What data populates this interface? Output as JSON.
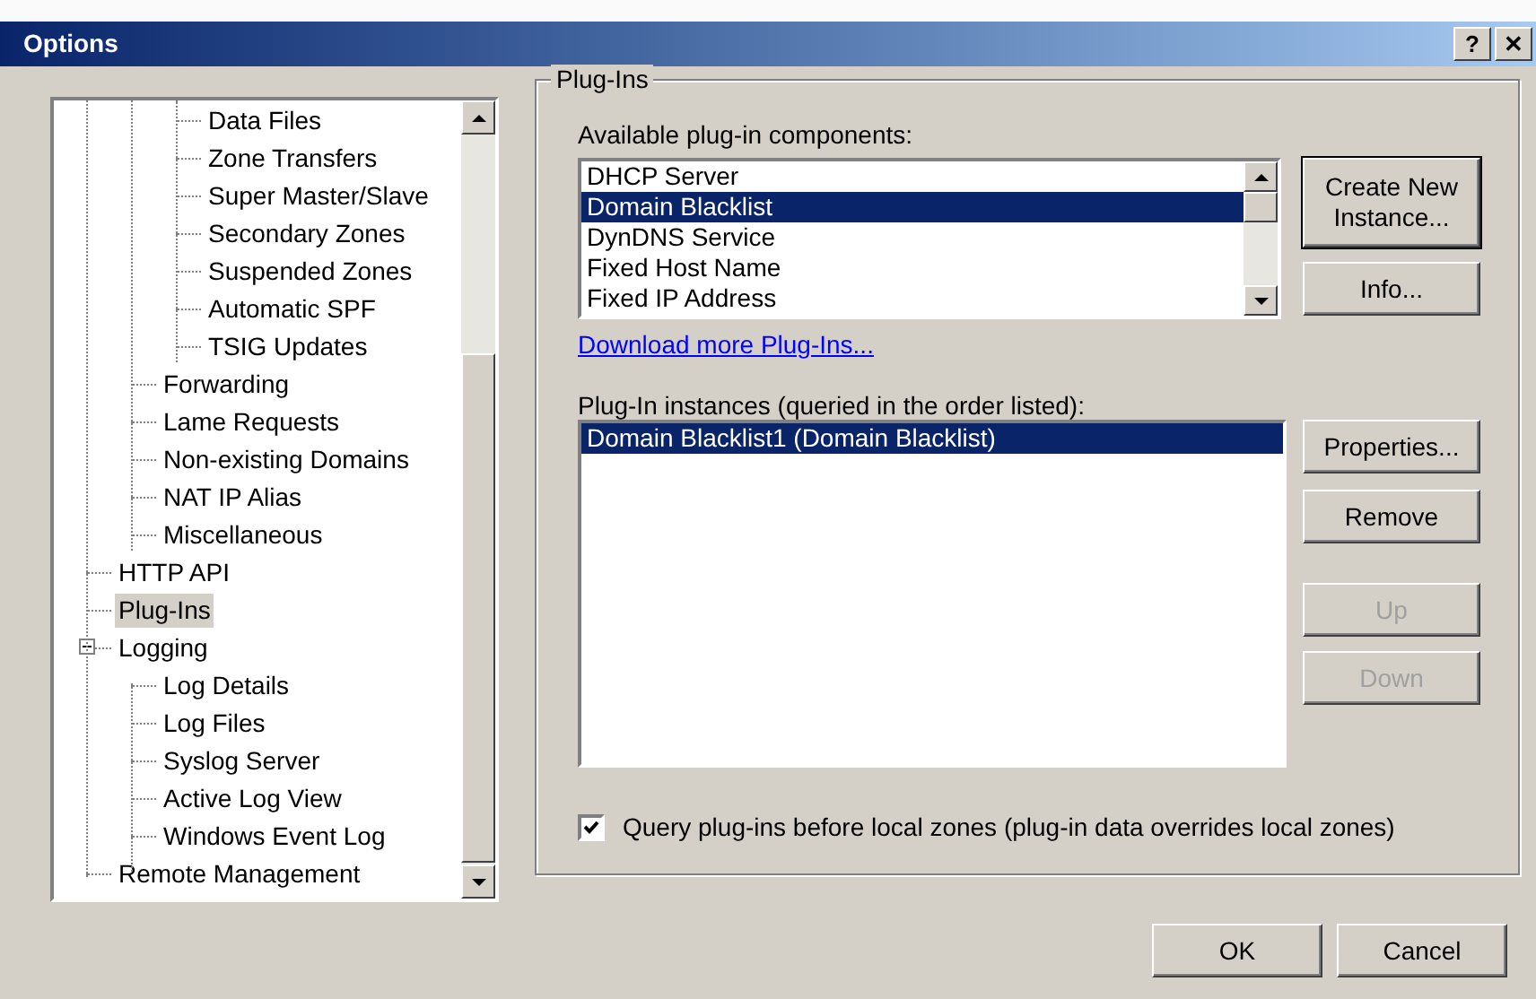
{
  "window": {
    "title": "Options",
    "help_button": "?",
    "close_button": "✕"
  },
  "tree": {
    "items": [
      {
        "children": [
          {
            "children": [
              {
                "label": "Data Files",
                "selected": false
              },
              {
                "label": "Zone Transfers",
                "selected": false
              },
              {
                "label": "Super Master/Slave",
                "selected": false
              },
              {
                "label": "Secondary Zones",
                "selected": false
              },
              {
                "label": "Suspended Zones",
                "selected": false
              },
              {
                "label": "Automatic SPF",
                "selected": false
              },
              {
                "label": "TSIG Updates",
                "selected": false
              }
            ]
          },
          {
            "label": "Forwarding",
            "selected": false
          },
          {
            "label": "Lame Requests",
            "selected": false
          },
          {
            "label": "Non-existing Domains",
            "selected": false
          },
          {
            "label": "NAT IP Alias",
            "selected": false
          },
          {
            "label": "Miscellaneous",
            "selected": false
          }
        ]
      },
      {
        "label": "HTTP API",
        "selected": false
      },
      {
        "label": "Plug-Ins",
        "selected": true
      },
      {
        "label": "Logging",
        "selected": false,
        "expanded": true,
        "children": [
          {
            "label": "Log Details",
            "selected": false
          },
          {
            "label": "Log Files",
            "selected": false
          },
          {
            "label": "Syslog Server",
            "selected": false
          },
          {
            "label": "Active Log View",
            "selected": false
          },
          {
            "label": "Windows Event Log",
            "selected": false
          }
        ]
      },
      {
        "label": "Remote Management",
        "selected": false
      }
    ]
  },
  "group": {
    "title": "Plug-Ins",
    "available_label": "Available plug-in components:",
    "available": [
      {
        "label": "DHCP Server",
        "selected": false
      },
      {
        "label": "Domain Blacklist",
        "selected": true
      },
      {
        "label": "DynDNS Service",
        "selected": false
      },
      {
        "label": "Fixed Host Name",
        "selected": false
      },
      {
        "label": "Fixed IP Address",
        "selected": false
      }
    ],
    "available_buttons": [
      {
        "label": "Create New Instance...",
        "disabled": false
      },
      {
        "label": "Info...",
        "disabled": false
      }
    ],
    "download_link": "Download more Plug-Ins...",
    "instances_label": "Plug-In instances (queried in the order listed):",
    "instances": [
      {
        "label": "Domain Blacklist1 (Domain Blacklist)",
        "selected": true
      }
    ],
    "instance_buttons": [
      {
        "label": "Properties...",
        "disabled": false
      },
      {
        "label": "Remove",
        "disabled": false
      },
      {
        "label": "Up",
        "disabled": true
      },
      {
        "label": "Down",
        "disabled": true
      }
    ],
    "query_first": {
      "label": "Query plug-ins before local zones (plug-in data overrides local zones)",
      "checked": true
    }
  },
  "buttons": [
    "OK",
    "Cancel"
  ]
}
